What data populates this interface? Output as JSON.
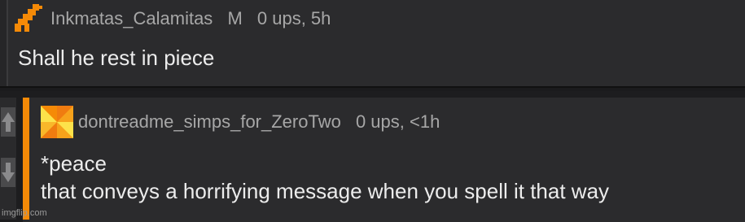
{
  "top_comment": {
    "username": "Inkmatas_Calamitas",
    "gender": "M",
    "ups": "0 ups, 5h",
    "text": "Shall he rest in piece",
    "avatar_icon": "orange-pixel-creature-icon"
  },
  "reply_comment": {
    "username": "dontreadme_simps_for_ZeroTwo",
    "ups": "0 ups, <1h",
    "text_line1": "*peace",
    "text_line2": "that conveys a horrifying message when you spell it that way",
    "avatar_icon": "orange-pinwheel-icon",
    "accent_color": "#f58a07"
  },
  "votes": {
    "up_icon": "upvote-arrow-icon",
    "down_icon": "downvote-arrow-icon"
  },
  "watermark": "imgflip.com"
}
